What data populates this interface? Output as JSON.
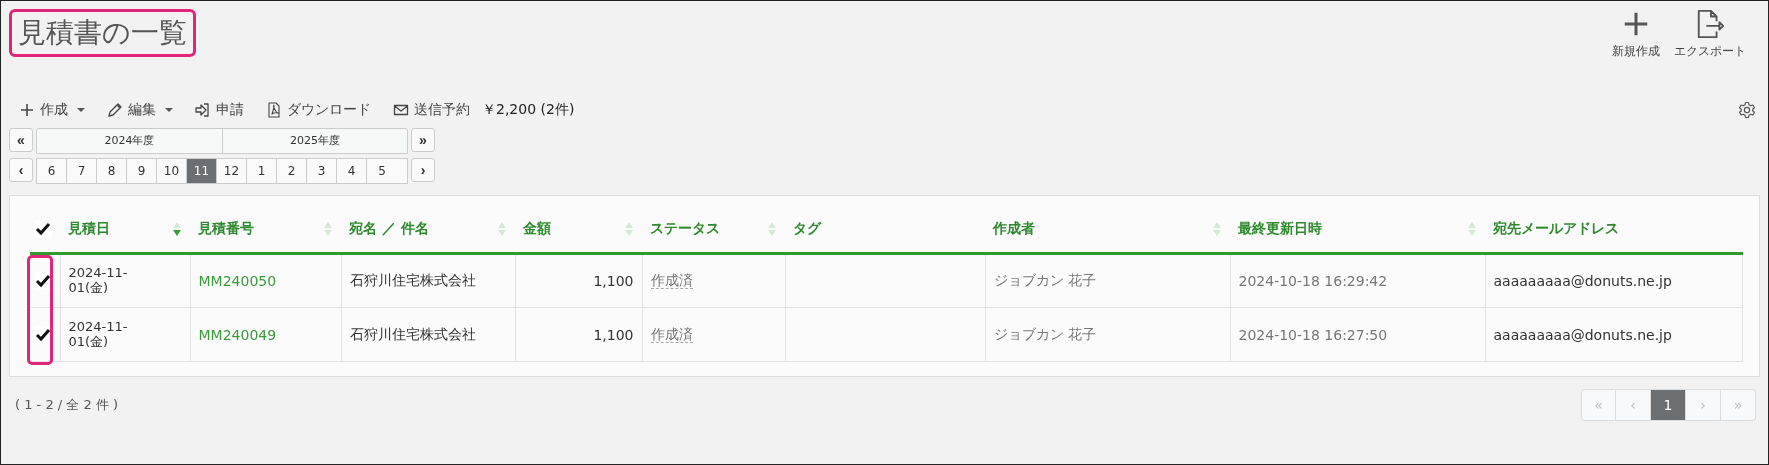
{
  "title": {
    "text": "見積書の一覧",
    "highlighted": true
  },
  "header_actions": [
    {
      "kind": "plus",
      "label": "新規作成"
    },
    {
      "kind": "export",
      "label": "エクスポート"
    }
  ],
  "toolbar": [
    {
      "kind": "plus",
      "label": "作成",
      "dropdown": true
    },
    {
      "kind": "pencil",
      "label": "編集",
      "dropdown": true
    },
    {
      "kind": "submit",
      "label": "申請",
      "dropdown": false
    },
    {
      "kind": "pdf",
      "label": "ダウンロード",
      "dropdown": false
    },
    {
      "kind": "mail",
      "label": "送信予約",
      "dropdown": false
    }
  ],
  "total": "￥2,200 (2件)",
  "period": {
    "years": [
      {
        "label": "2024年度",
        "months": [
          {
            "label": "6",
            "selected": false
          },
          {
            "label": "7",
            "selected": false
          },
          {
            "label": "8",
            "selected": false
          },
          {
            "label": "9",
            "selected": false
          },
          {
            "label": "10",
            "selected": false
          },
          {
            "label": "11",
            "selected": true
          }
        ]
      },
      {
        "label": "2025年度",
        "months": [
          {
            "label": "12",
            "selected": false
          },
          {
            "label": "1",
            "selected": false
          },
          {
            "label": "2",
            "selected": false
          },
          {
            "label": "3",
            "selected": false
          },
          {
            "label": "4",
            "selected": false
          },
          {
            "label": "5",
            "selected": false
          }
        ]
      }
    ],
    "prev_year": "«",
    "prev_month": "‹",
    "next_year": "»",
    "next_month": "›"
  },
  "table": {
    "all_checked": true,
    "checkbox_column_highlighted": true,
    "columns": [
      {
        "label": "見積日",
        "sortable": true,
        "sorted_desc": true
      },
      {
        "label": "見積番号",
        "sortable": true,
        "sorted_desc": false
      },
      {
        "label": "宛名 ／ 件名",
        "sortable": true,
        "sorted_desc": false
      },
      {
        "label": "金額",
        "sortable": true,
        "sorted_desc": false
      },
      {
        "label": "ステータス",
        "sortable": true,
        "sorted_desc": false
      },
      {
        "label": "タグ"
      },
      {
        "label": "作成者",
        "sortable": true,
        "sorted_desc": false
      },
      {
        "label": "最終更新日時",
        "sortable": true,
        "sorted_desc": false
      },
      {
        "label": "宛先メールアドレス"
      }
    ],
    "rows": [
      {
        "checked": true,
        "date": "2024-11-01(金)",
        "number": "MM240050",
        "recipient": "石狩川住宅株式会社",
        "amount": "1,100",
        "status": "作成済",
        "author": "ジョブカン 花子",
        "updated": "2024-10-18 16:29:42",
        "email": "aaaaaaaaa@donuts.ne.jp"
      },
      {
        "checked": true,
        "date": "2024-11-01(金)",
        "number": "MM240049",
        "recipient": "石狩川住宅株式会社",
        "amount": "1,100",
        "status": "作成済",
        "author": "ジョブカン 花子",
        "updated": "2024-10-18 16:27:50",
        "email": "aaaaaaaaa@donuts.ne.jp"
      }
    ]
  },
  "footer": {
    "count": "( 1 - 2 / 全 2 件 )",
    "pagination": [
      {
        "label": "«",
        "selected": false,
        "disabled": true
      },
      {
        "label": "‹",
        "selected": false,
        "disabled": true
      },
      {
        "label": "1",
        "selected": true,
        "disabled": false
      },
      {
        "label": "›",
        "selected": false,
        "disabled": true
      },
      {
        "label": "»",
        "selected": false,
        "disabled": true
      }
    ]
  }
}
